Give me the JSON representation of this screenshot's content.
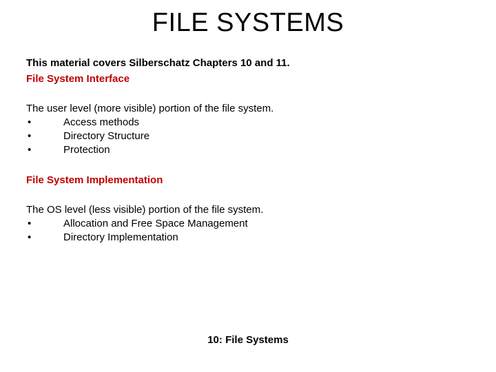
{
  "title": "FILE SYSTEMS",
  "coverage": "This material covers Silberschatz Chapters 10 and 11.",
  "section1": {
    "heading": "File System Interface",
    "intro": "The user level (more visible) portion of the file system.",
    "bullets": [
      "Access methods",
      "Directory Structure",
      "Protection"
    ]
  },
  "section2": {
    "heading": "File System Implementation",
    "intro": "The OS level (less visible) portion of the file system.",
    "bullets": [
      "Allocation and Free Space Management",
      "Directory Implementation"
    ]
  },
  "footer": "10: File Systems",
  "bullet_char": "•"
}
